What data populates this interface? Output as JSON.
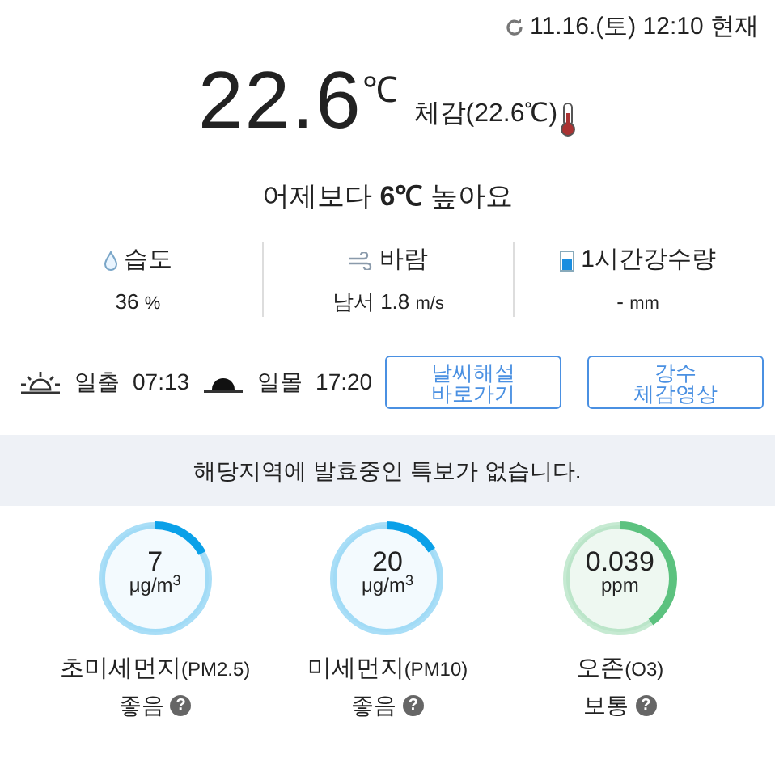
{
  "updated": "11.16.(토) 12:10 현재",
  "temperature": {
    "value": "22.6",
    "unit": "℃",
    "feels_like": "체감(22.6℃)"
  },
  "compare": "어제보다 **6℃** 높아요",
  "stats": [
    {
      "kind": "humidity",
      "label": "습도",
      "value": "36",
      "unit": "%"
    },
    {
      "kind": "wind",
      "label": "바람",
      "value": "남서 1.8",
      "unit": "m/s"
    },
    {
      "kind": "rain",
      "label": "1시간강수량",
      "value": "-",
      "unit": "mm"
    }
  ],
  "sun": [
    {
      "kind": "sunrise",
      "label": "일출",
      "time": "07:13"
    },
    {
      "kind": "sunset",
      "label": "일몰",
      "time": "17:20"
    }
  ],
  "buttons": [
    {
      "lines": [
        "날씨해설",
        "바로가기"
      ]
    },
    {
      "lines": [
        "강수",
        "체감영상"
      ]
    }
  ],
  "alert": "해당지역에 발효중인 특보가 없습니다.",
  "air": [
    {
      "value": "7",
      "unit": "μg/m$^{3}$",
      "name": "초미세먼지",
      "code": "(PM2.5)",
      "grade": "좋음",
      "help": "?",
      "color": "#0aa0e8"
    },
    {
      "value": "20",
      "unit": "μg/m$^{3}$",
      "name": "미세먼지",
      "code": "(PM10)",
      "grade": "좋음",
      "help": "?",
      "color": "#0aa0e8"
    },
    {
      "value": "0.039",
      "unit": "ppm",
      "name": "오존",
      "code": "(O3)",
      "grade": "보통",
      "help": "?",
      "color": "#5cc27f"
    }
  ]
}
